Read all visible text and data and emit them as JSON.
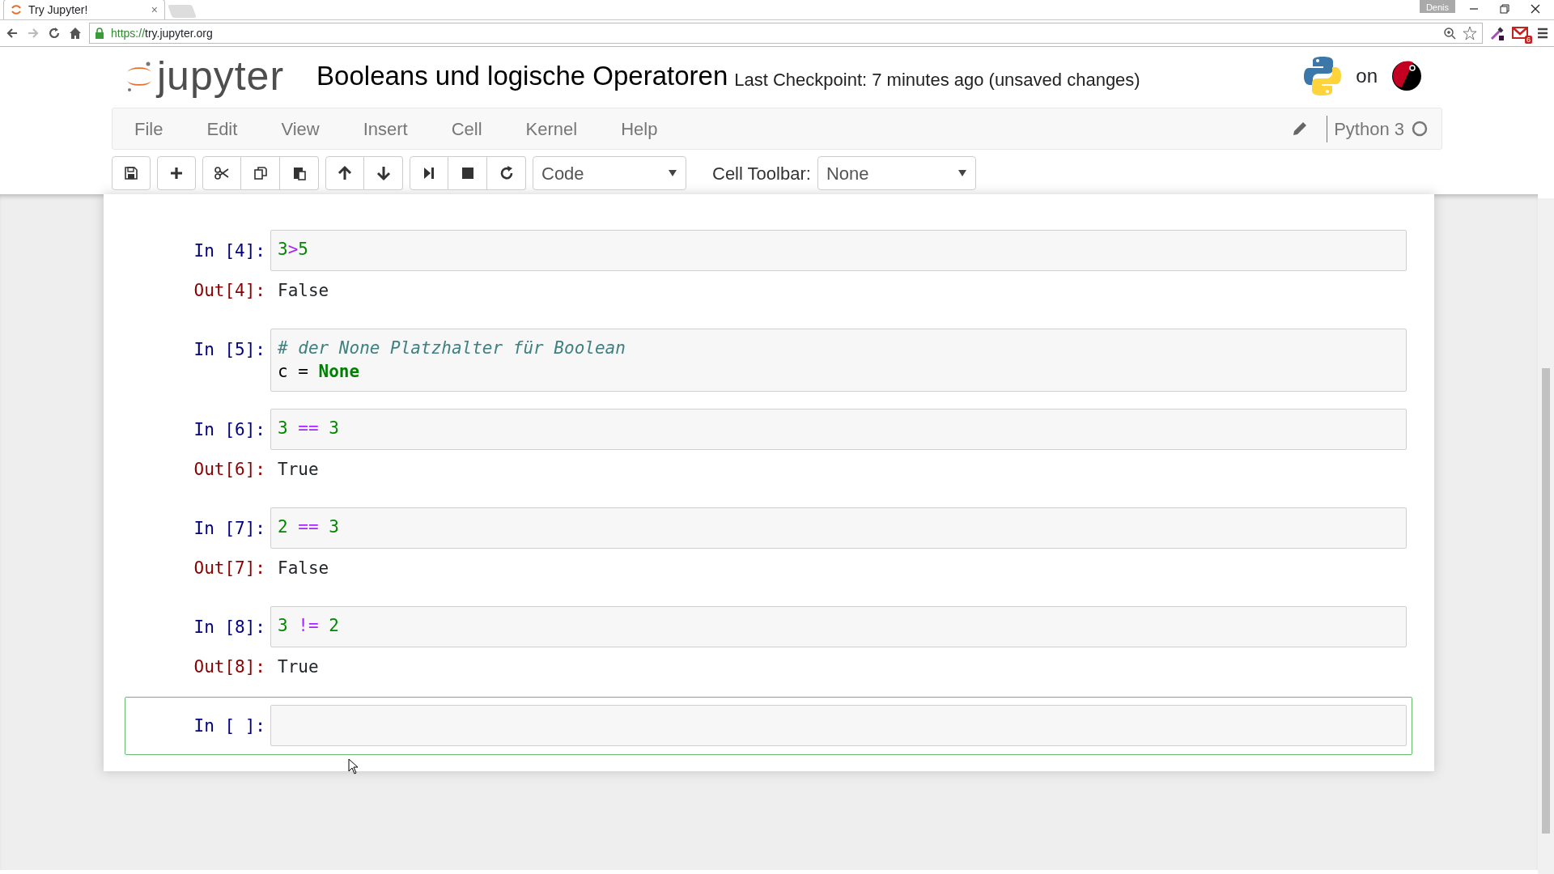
{
  "browser": {
    "tab": {
      "title": "Try Jupyter!",
      "close": "×",
      "selected": true
    },
    "profile": "Denis",
    "url": {
      "scheme": "https://",
      "host": "try.jupyter.org"
    },
    "mail_badge": "6"
  },
  "header": {
    "logo_text": "jupyter",
    "notebook_name": "Booleans und logische Operatoren",
    "checkpoint": "Last Checkpoint: 7 minutes ago (unsaved changes)",
    "on_text": "on"
  },
  "menu": [
    "File",
    "Edit",
    "View",
    "Insert",
    "Cell",
    "Kernel",
    "Help"
  ],
  "kernel": {
    "name": "Python 3",
    "busy": false
  },
  "toolbar": {
    "cell_type": "Code",
    "cell_toolbar_label": "Cell Toolbar:",
    "cell_toolbar": "None"
  },
  "cells": [
    {
      "prompt": "In [4]:",
      "selected": false,
      "code": [
        [
          {
            "kind": "number",
            "text": "3"
          },
          {
            "kind": "operator",
            "text": ">"
          },
          {
            "kind": "number",
            "text": "5"
          }
        ]
      ],
      "out_prompt": "Out[4]:",
      "output": "False"
    },
    {
      "prompt": "In [5]:",
      "selected": false,
      "code": [
        [
          {
            "kind": "comment",
            "text": "# der None Platzhalter für Boolean"
          }
        ],
        [
          {
            "kind": "plain",
            "text": "c = "
          },
          {
            "kind": "keyword",
            "text": "None"
          }
        ]
      ]
    },
    {
      "prompt": "In [6]:",
      "selected": false,
      "code": [
        [
          {
            "kind": "number",
            "text": "3"
          },
          {
            "kind": "operator",
            "text": " == "
          },
          {
            "kind": "number",
            "text": "3"
          }
        ]
      ],
      "out_prompt": "Out[6]:",
      "output": "True"
    },
    {
      "prompt": "In [7]:",
      "selected": false,
      "code": [
        [
          {
            "kind": "number",
            "text": "2"
          },
          {
            "kind": "operator",
            "text": " == "
          },
          {
            "kind": "number",
            "text": "3"
          }
        ]
      ],
      "out_prompt": "Out[7]:",
      "output": "False"
    },
    {
      "prompt": "In [8]:",
      "selected": false,
      "code": [
        [
          {
            "kind": "number",
            "text": "3"
          },
          {
            "kind": "operator",
            "text": " != "
          },
          {
            "kind": "number",
            "text": "2"
          }
        ]
      ],
      "out_prompt": "Out[8]:",
      "output": "True"
    },
    {
      "prompt": "In [ ]:",
      "selected": true
    }
  ]
}
